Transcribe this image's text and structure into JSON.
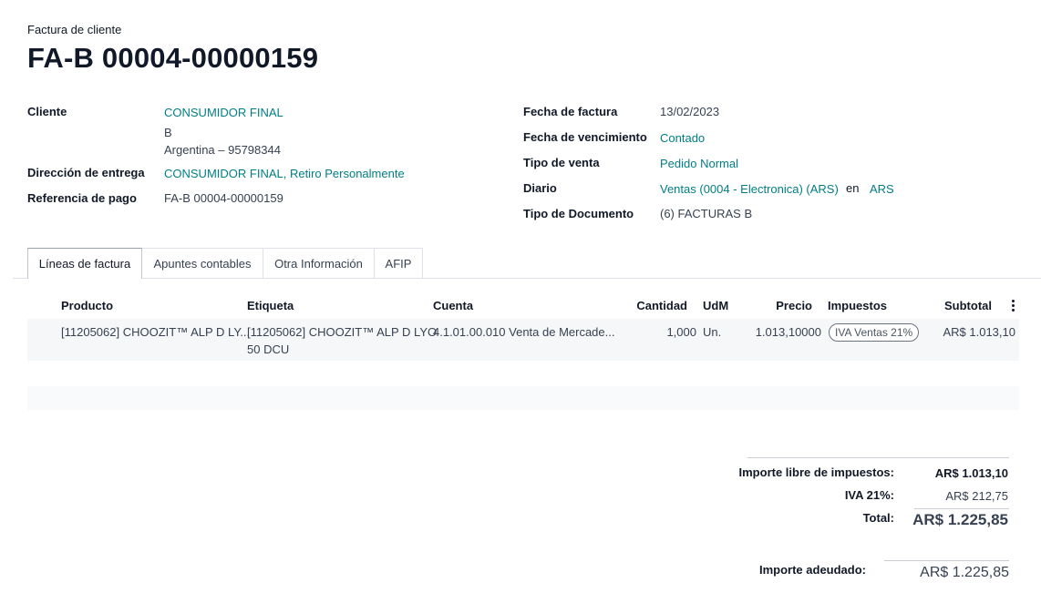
{
  "header": {
    "doc_type": "Factura de cliente",
    "title": "FA-B 00004-00000159"
  },
  "left_fields": {
    "cliente_label": "Cliente",
    "cliente_name": "CONSUMIDOR FINAL",
    "cliente_line2": "B",
    "cliente_line3": "Argentina – 95798344",
    "entrega_label": "Dirección de entrega",
    "entrega_value": "CONSUMIDOR FINAL, Retiro Personalmente",
    "referencia_label": "Referencia de pago",
    "referencia_value": "FA-B 00004-00000159"
  },
  "right_fields": {
    "fecha_factura_label": "Fecha de factura",
    "fecha_factura_value": "13/02/2023",
    "vencimiento_label": "Fecha de vencimiento",
    "vencimiento_value": "Contado",
    "tipo_venta_label": "Tipo de venta",
    "tipo_venta_value": "Pedido Normal",
    "diario_label": "Diario",
    "diario_value": "Ventas (0004 - Electronica) (ARS)",
    "diario_en": "en",
    "diario_currency": "ARS",
    "tipo_doc_label": "Tipo de Documento",
    "tipo_doc_value": "(6) FACTURAS B"
  },
  "tabs": [
    {
      "label": "Líneas de factura",
      "active": true
    },
    {
      "label": "Apuntes contables",
      "active": false
    },
    {
      "label": "Otra Información",
      "active": false
    },
    {
      "label": "AFIP",
      "active": false
    }
  ],
  "table": {
    "headers": {
      "producto": "Producto",
      "etiqueta": "Etiqueta",
      "cuenta": "Cuenta",
      "cantidad": "Cantidad",
      "udm": "UdM",
      "precio": "Precio",
      "impuestos": "Impuestos",
      "subtotal": "Subtotal"
    },
    "rows": [
      {
        "producto": "[11205062] CHOOZIT™ ALP D LY...",
        "etiqueta_l1": "[11205062] CHOOZIT™ ALP D LYO",
        "etiqueta_l2": "50 DCU",
        "cuenta": "4.1.01.00.010 Venta de Mercade...",
        "cantidad": "1,000",
        "udm": "Un.",
        "precio": "1.013,10000",
        "impuestos": "IVA Ventas 21%",
        "subtotal": "AR$ 1.013,10"
      }
    ]
  },
  "totals": {
    "libre_label": "Importe libre de impuestos:",
    "libre_value": "AR$ 1.013,10",
    "iva_label": "IVA 21%:",
    "iva_value": "AR$ 212,75",
    "total_label": "Total:",
    "total_value": "AR$ 1.225,85",
    "adeudado_label": "Importe adeudado:",
    "adeudado_value": "AR$ 1.225,85"
  },
  "colors": {
    "link": "#017e84",
    "text": "#212529"
  }
}
